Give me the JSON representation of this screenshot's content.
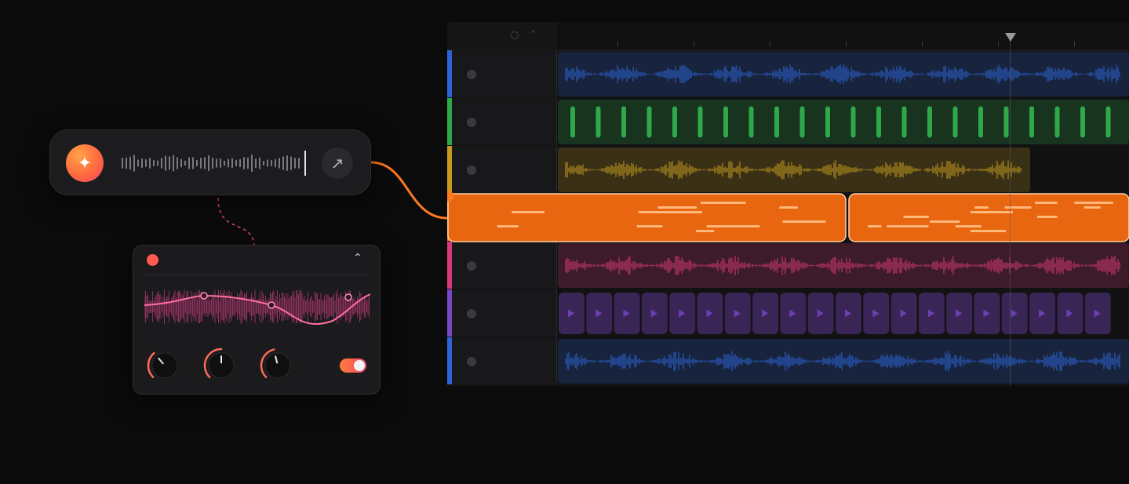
{
  "colors": {
    "background": "#0b0b0c",
    "accent_orange": "#ff7a1f",
    "accent_pink": "#e2457a",
    "track_blue": "#2e63d6",
    "track_green": "#2fa84a",
    "track_yellow": "#c69a1e",
    "track_orange": "#ff7a1f",
    "track_magenta": "#d63a78",
    "track_purple": "#7a46c8"
  },
  "prompt": {
    "ai_icon": "sparkle-icon",
    "send_icon": "arrow-up-right-icon"
  },
  "tracks": [
    {
      "type": "audio",
      "color": "#2e63d6"
    },
    {
      "type": "audio",
      "color": "#2fa84a"
    },
    {
      "type": "audio",
      "color": "#c69a1e"
    },
    {
      "type": "midi",
      "color": "#ff7a1f",
      "selected": true
    },
    {
      "type": "audio",
      "color": "#d63a78"
    },
    {
      "type": "video",
      "color": "#7a46c8"
    },
    {
      "type": "audio",
      "color": "#2e63d6"
    }
  ],
  "effect_panel": {
    "record_icon": "record-dot-icon",
    "collapse_icon": "chevron-up-icon",
    "knob_values": [
      0.35,
      0.5,
      0.45
    ],
    "toggle_on": true
  }
}
